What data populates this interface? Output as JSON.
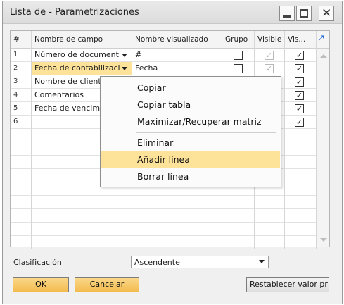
{
  "window": {
    "title": "Lista de - Parametrizaciones",
    "close_glyph": "✕"
  },
  "grid": {
    "columns": [
      "#",
      "Nombre de campo",
      "Nombre visualizado",
      "Grupo",
      "Visible",
      "Vis..."
    ],
    "rows": [
      {
        "num": "1",
        "field": "Número de document",
        "display": "#",
        "grupo": false,
        "visible": true,
        "vis": true
      },
      {
        "num": "2",
        "field": "Fecha de contabilizaci",
        "display": "Fecha",
        "grupo": false,
        "visible": true,
        "vis": true
      },
      {
        "num": "3",
        "field": "Nombre de client",
        "display": "",
        "grupo": null,
        "visible": null,
        "vis": true
      },
      {
        "num": "4",
        "field": "Comentarios",
        "display": "",
        "grupo": null,
        "visible": null,
        "vis": true
      },
      {
        "num": "5",
        "field": "Fecha de vencim",
        "display": "",
        "grupo": null,
        "visible": null,
        "vis": true
      },
      {
        "num": "6",
        "field": "",
        "display": "",
        "grupo": null,
        "visible": null,
        "vis": true
      }
    ],
    "check_glyph": "✓",
    "resize_icon": "expand-arrow-icon"
  },
  "context_menu": {
    "items": [
      "Copiar",
      "Copiar tabla",
      "Maximizar/Recuperar matriz",
      "Eliminar",
      "Añadir línea",
      "Borrar línea"
    ],
    "active_index": 4
  },
  "footer": {
    "sort_label": "Clasificación",
    "sort_value": "Ascendente",
    "ok_label": "OK",
    "cancel_label": "Cancelar",
    "reset_label": "Restablecer valor pr"
  },
  "colors": {
    "highlight": "#fde29a",
    "button_accent": "#f3bb4f"
  }
}
